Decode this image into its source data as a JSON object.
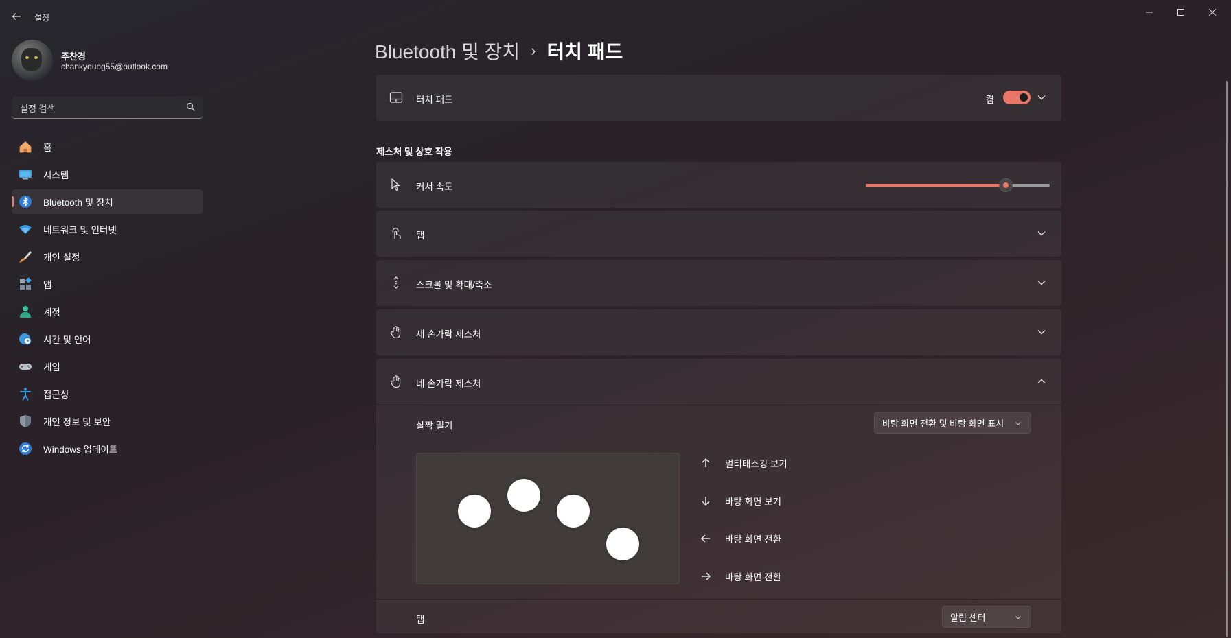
{
  "window": {
    "app_title": "설정",
    "back_icon": "back-arrow-icon",
    "controls": [
      "minimize-icon",
      "maximize-icon",
      "close-icon"
    ]
  },
  "user": {
    "name": "주찬경",
    "email": "chankyoung55@outlook.com"
  },
  "search": {
    "placeholder": "설정 검색",
    "icon": "search-icon"
  },
  "sidebar": {
    "items": [
      {
        "label": "홈",
        "icon": "home-icon"
      },
      {
        "label": "시스템",
        "icon": "system-icon"
      },
      {
        "label": "Bluetooth 및 장치",
        "icon": "bluetooth-icon",
        "active": true
      },
      {
        "label": "네트워크 및 인터넷",
        "icon": "wifi-icon"
      },
      {
        "label": "개인 설정",
        "icon": "brush-icon"
      },
      {
        "label": "앱",
        "icon": "apps-icon"
      },
      {
        "label": "계정",
        "icon": "account-icon"
      },
      {
        "label": "시간 및 언어",
        "icon": "globe-clock-icon"
      },
      {
        "label": "게임",
        "icon": "gamepad-icon"
      },
      {
        "label": "접근성",
        "icon": "accessibility-icon"
      },
      {
        "label": "개인 정보 및 보안",
        "icon": "shield-icon"
      },
      {
        "label": "Windows 업데이트",
        "icon": "update-icon"
      }
    ]
  },
  "breadcrumb": {
    "parent": "Bluetooth 및 장치",
    "separator": "›",
    "current": "터치 패드"
  },
  "touchpad_card": {
    "label": "터치 패드",
    "toggle_text": "켬",
    "toggle_on": true
  },
  "section_title": "제스처 및 상호 작용",
  "cursor_speed": {
    "label": "커서 속도",
    "value_fraction": 0.76
  },
  "rows": {
    "tap": "탭",
    "scroll_zoom": "스크롤 및 확대/축소",
    "three_finger": "세 손가락 제스처",
    "four_finger": "네 손가락 제스처"
  },
  "four_finger_panel": {
    "swipe_label": "살짝 밀기",
    "swipe_value": "바탕 화면 전환 및 바탕 화면 표시",
    "gestures": [
      {
        "direction": "up-arrow-icon",
        "label": "멀티태스킹 보기"
      },
      {
        "direction": "down-arrow-icon",
        "label": "바탕 화면 보기"
      },
      {
        "direction": "left-arrow-icon",
        "label": "바탕 화면 전환"
      },
      {
        "direction": "right-arrow-icon",
        "label": "바탕 화면 전환"
      }
    ],
    "tap_label": "탭",
    "tap_value": "알림 센터"
  },
  "colors": {
    "accent": "#e8776a",
    "background": "#2a2228",
    "card": "#343033"
  }
}
